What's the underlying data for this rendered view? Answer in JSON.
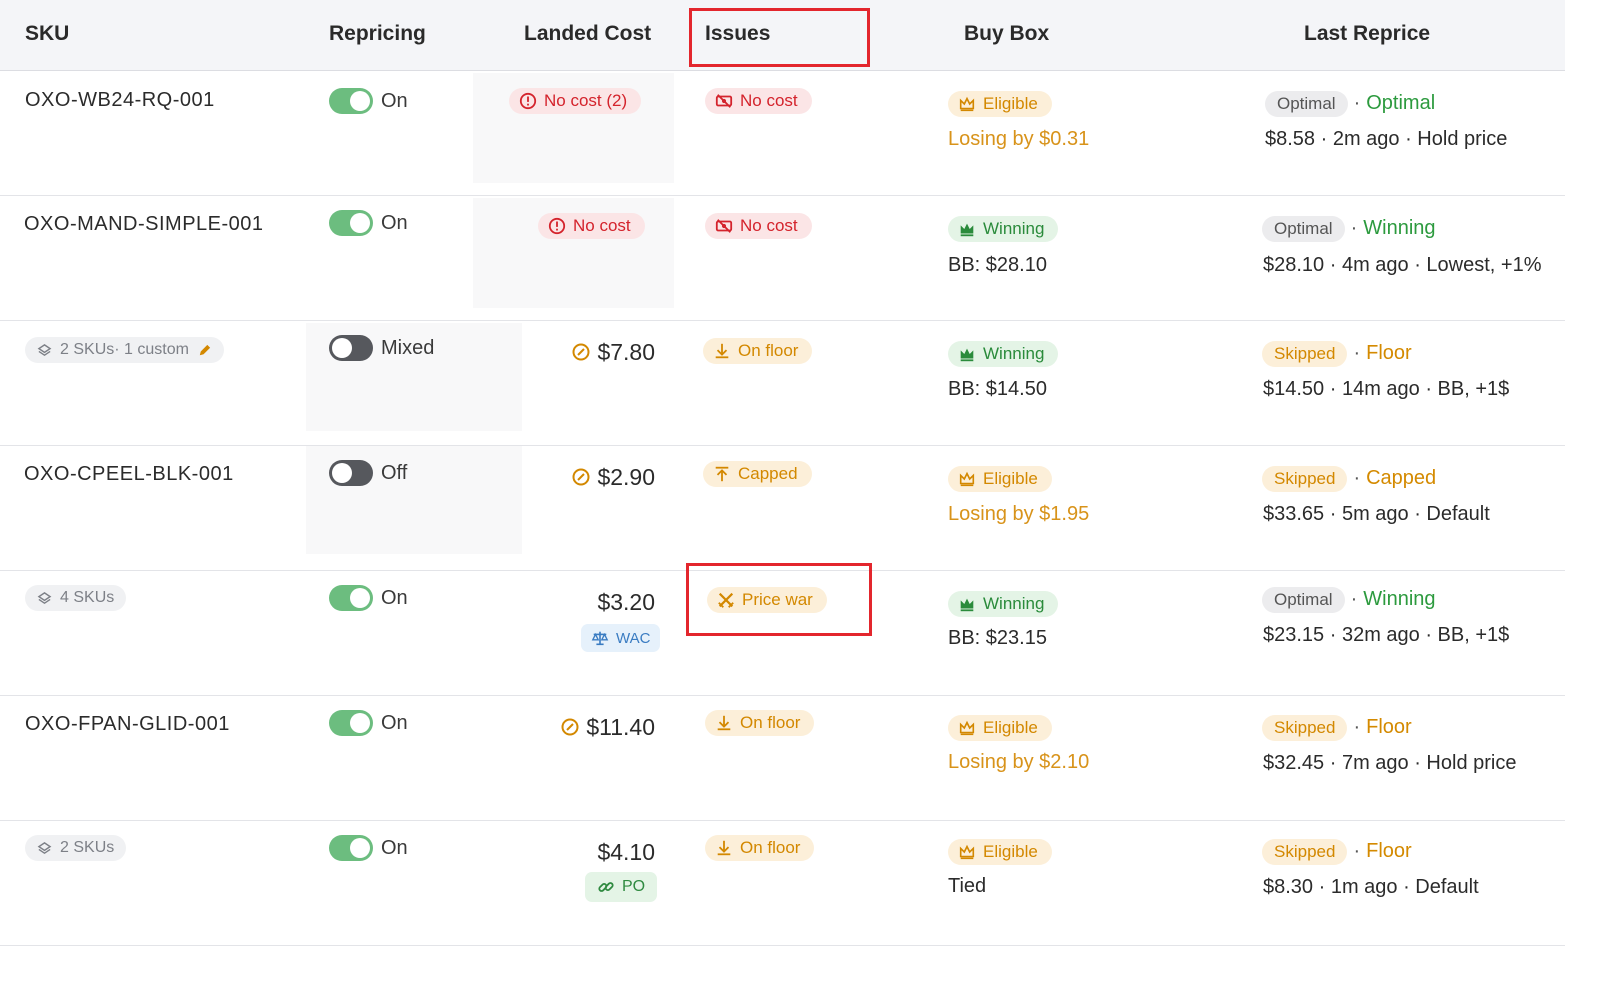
{
  "columns": {
    "sku": "SKU",
    "repricing": "Repricing",
    "landed_cost": "Landed Cost",
    "issues": "Issues",
    "buy_box": "Buy Box",
    "last_reprice": "Last Reprice"
  },
  "rows": [
    {
      "sku": "OXO-WB24-RQ-001",
      "repricing": "On",
      "cost_badge": "No cost (2)",
      "issue": "No cost",
      "bb_badge": "Eligible",
      "bb_sub": "Losing by $0.31",
      "rep_status": "Optimal",
      "rep_word": "Optimal",
      "rep_line": "$8.58 · 2m ago · Hold price"
    },
    {
      "sku": "OXO-MAND-SIMPLE-001",
      "repricing": "On",
      "cost_badge": "No cost",
      "issue": "No cost",
      "bb_badge": "Winning",
      "bb_sub": "BB: $28.10",
      "rep_status": "Optimal",
      "rep_word": "Winning",
      "rep_line": "$28.10 · 4m ago · Lowest, +1%"
    },
    {
      "sku_group": "2 SKUs· 1 custom",
      "repricing": "Mixed",
      "cost": "$7.80",
      "issue": "On floor",
      "bb_badge": "Winning",
      "bb_sub": "BB: $14.50",
      "rep_status": "Skipped",
      "rep_word": "Floor",
      "rep_line": "$14.50 · 14m ago · BB, +1$"
    },
    {
      "sku": "OXO-CPEEL-BLK-001",
      "repricing": "Off",
      "cost": "$2.90",
      "issue": "Capped",
      "bb_badge": "Eligible",
      "bb_sub": "Losing by $1.95",
      "rep_status": "Skipped",
      "rep_word": "Capped",
      "rep_line": "$33.65 · 5m ago · Default"
    },
    {
      "sku_group": "4 SKUs",
      "repricing": "On",
      "cost": "$3.20",
      "cost_tag": "WAC",
      "issue": "Price war",
      "bb_badge": "Winning",
      "bb_sub": "BB: $23.15",
      "rep_status": "Optimal",
      "rep_word": "Winning",
      "rep_line": "$23.15 · 32m ago · BB, +1$"
    },
    {
      "sku": "OXO-FPAN-GLID-001",
      "repricing": "On",
      "cost": "$11.40",
      "issue": "On floor",
      "bb_badge": "Eligible",
      "bb_sub": "Losing by $2.10",
      "rep_status": "Skipped",
      "rep_word": "Floor",
      "rep_line": "$32.45 · 7m ago · Hold price"
    },
    {
      "sku_group": "2 SKUs",
      "repricing": "On",
      "cost": "$4.10",
      "cost_tag": "PO",
      "issue": "On floor",
      "bb_badge": "Eligible",
      "bb_sub": "Tied",
      "rep_status": "Skipped",
      "rep_word": "Floor",
      "rep_line": "$8.30 · 1m ago · Default"
    }
  ],
  "dot": "·",
  "colors": {
    "highlight": "#e3262d",
    "toggle_on": "#6cbd7f",
    "toggle_off": "#56585d",
    "red": "#d4232c",
    "orange": "#d38800",
    "green": "#2a8b3b"
  }
}
